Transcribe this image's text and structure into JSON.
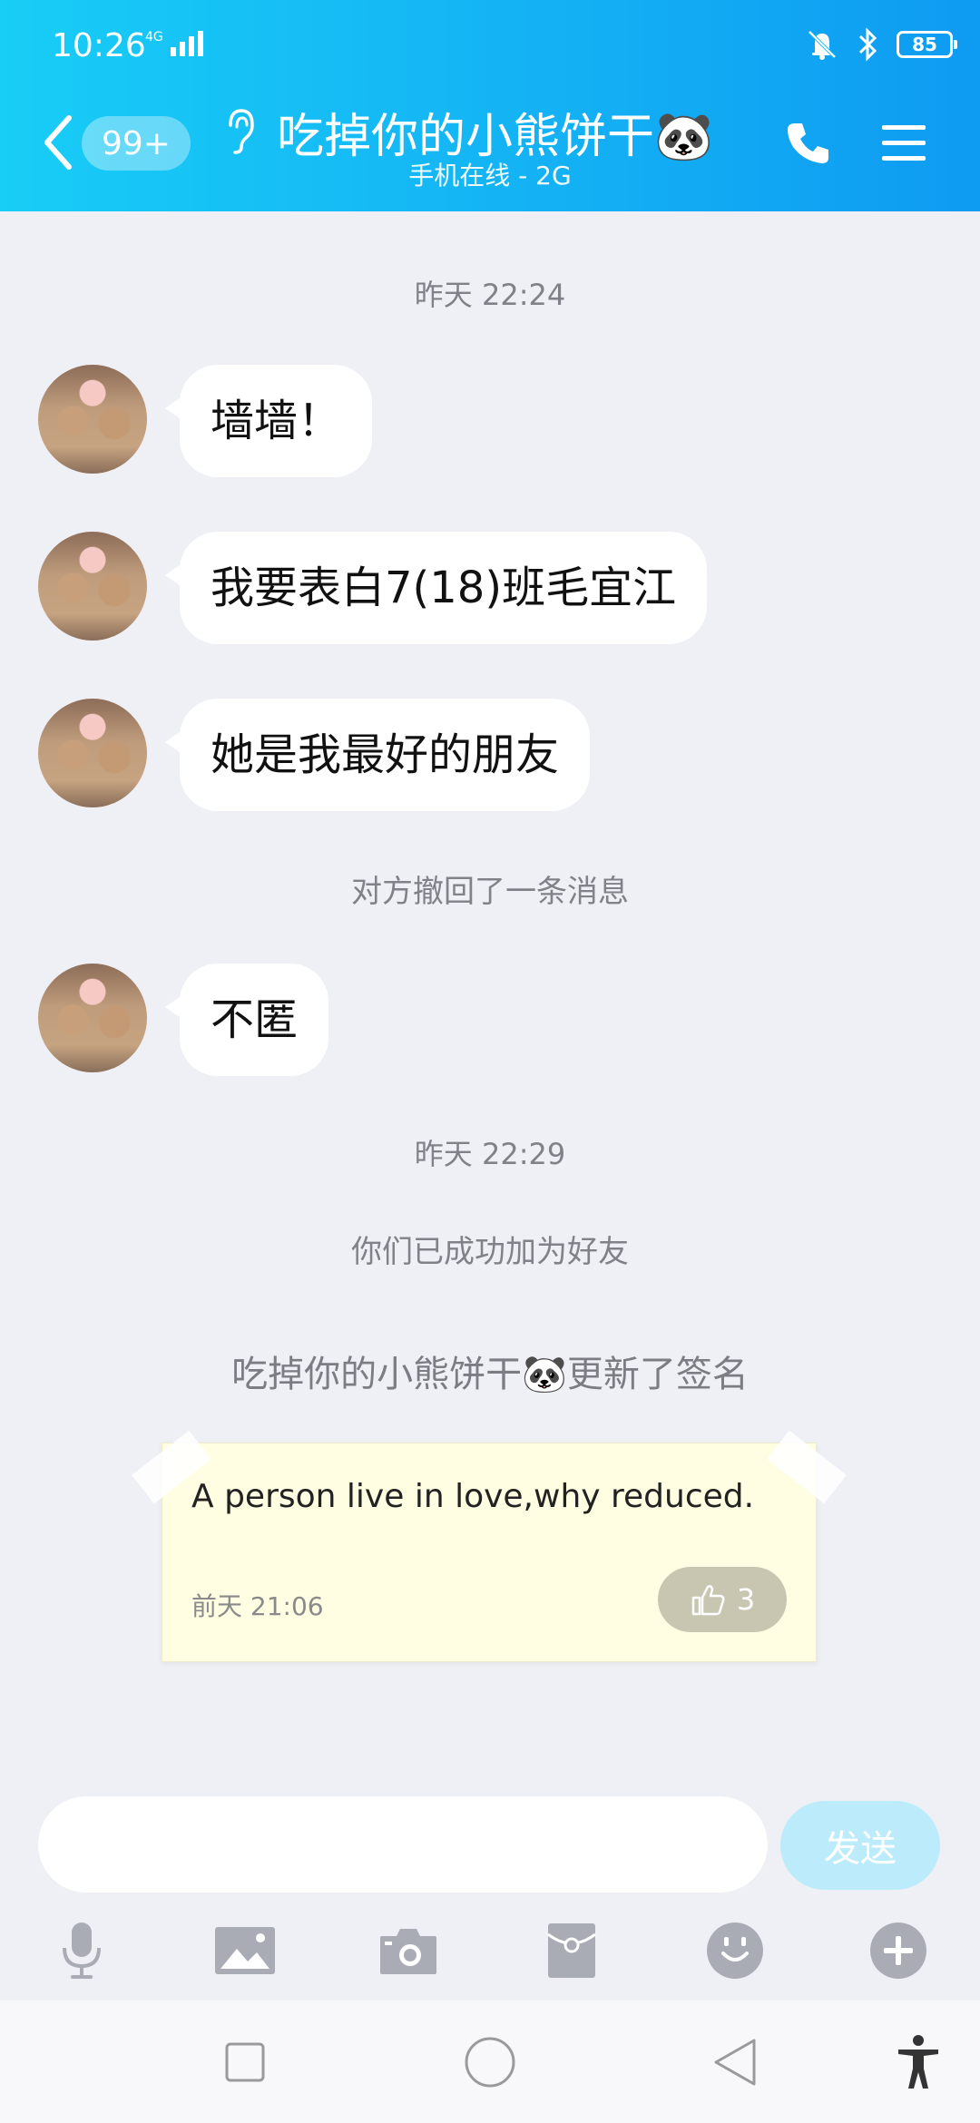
{
  "status_bar": {
    "time": "10:26",
    "network": "4G",
    "battery": "85"
  },
  "header": {
    "unread_count": "99+",
    "title": "吃掉你的小熊饼干🐼",
    "subtitle": "手机在线 - 2G"
  },
  "chat": {
    "timestamp_1": "昨天 22:24",
    "messages": [
      {
        "text": "墙墙！"
      },
      {
        "text": "我要表白7(18)班毛宜江"
      },
      {
        "text": "她是我最好的朋友"
      },
      {
        "text": "不匿"
      }
    ],
    "recall_notice": "对方撤回了一条消息",
    "timestamp_2": "昨天 22:29",
    "friend_notice": "你们已成功加为好友",
    "signature_notice": "吃掉你的小熊饼干🐼更新了签名",
    "signature_card": {
      "text": "A person live in love,why reduced.",
      "date": "前天 21:06",
      "likes": "3"
    }
  },
  "input": {
    "placeholder": "",
    "send_label": "发送"
  },
  "toolbar": {
    "items": [
      "microphone-icon",
      "image-icon",
      "camera-icon",
      "red-packet-icon",
      "emoji-icon",
      "plus-icon"
    ]
  },
  "colors": {
    "header_start": "#18cdf6",
    "header_end": "#0e9bf2",
    "chat_background": "#eef0f5",
    "send_button": "#bcecfb",
    "signature_card": "#fffee2"
  }
}
